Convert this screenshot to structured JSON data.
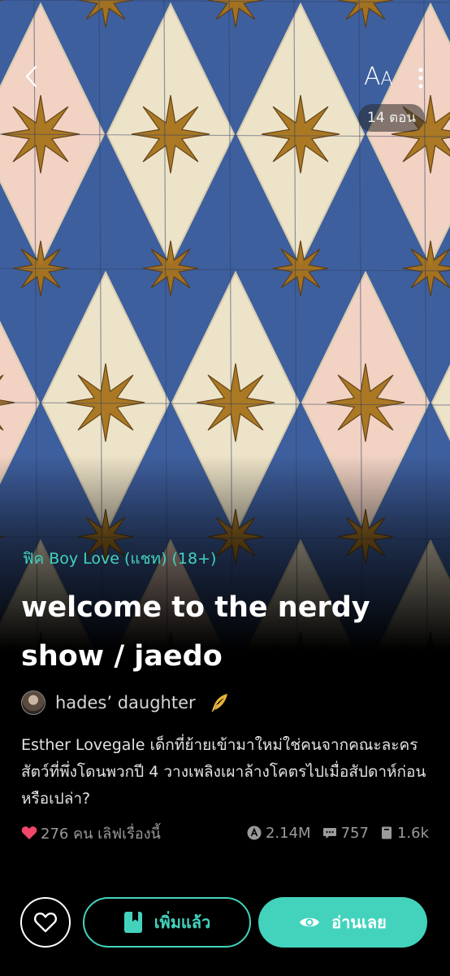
{
  "header": {
    "font_size_label_large": "A",
    "font_size_label_small": "A",
    "episode_count": "14 ตอน"
  },
  "story": {
    "genre": "ฟิค Boy Love (แชท) (18+)",
    "title": "welcome to the nerdy show / jaedo",
    "author": "hades’ daughter",
    "description": "Esther Lovegale เด็กที่ย้ายเข้ามาใหม่ใช่คนจากคณะละครสัตว์ที่พึ่งโดนพวกปี 4 วางเพลิงเผาล้างโคตรไปเมื่อสัปดาห์ก่อนหรือเปล่า?"
  },
  "stats": {
    "likes": "276 คน เลิฟเรื่องนี้",
    "views": "2.14M",
    "comments": "757",
    "chapters_read": "1.6k"
  },
  "actions": {
    "added_label": "เพิ่มแล้ว",
    "read_label": "อ่านเลย"
  },
  "colors": {
    "accent": "#43d3bd",
    "like_heart": "#f0476a",
    "background": "#000000",
    "tile_blue": "#3e5f9e",
    "tile_cream": "#ede3c8",
    "tile_pink": "#f1d2c3",
    "star_ochre": "#a8741c"
  }
}
